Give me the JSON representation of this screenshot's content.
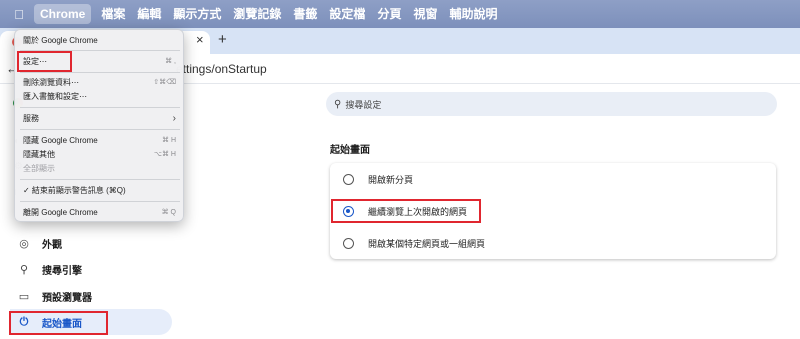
{
  "menubar": {
    "apple": "",
    "items": [
      "Chrome",
      "檔案",
      "編輯",
      "顯示方式",
      "瀏覽記錄",
      "書籤",
      "設定檔",
      "分頁",
      "視窗",
      "輔助說明"
    ]
  },
  "tabs": {
    "close": "×",
    "new": "+"
  },
  "address": {
    "back": "←",
    "url": "ettings/onStartup"
  },
  "search": {
    "icon": "⚲",
    "placeholder": "搜尋設定"
  },
  "chrome_menu": {
    "about": "關於 Google Chrome",
    "settings": "設定⋯",
    "settings_shortcut": "⌘ ,",
    "clear_data": "刪除瀏覽資料⋯",
    "clear_data_shortcut": "⇧⌘⌫",
    "import": "匯入書籤和設定⋯",
    "services": "服務",
    "services_chevron": "›",
    "hide": "隱藏 Google Chrome",
    "hide_shortcut": "⌘ H",
    "hide_others": "隱藏其他",
    "hide_others_shortcut": "⌥⌘ H",
    "show_all": "全部顯示",
    "warn_quit": "✓ 結束前顯示警告訊息 (⌘Q)",
    "quit": "離開 Google Chrome",
    "quit_shortcut": "⌘ Q"
  },
  "sidebar": {
    "partial_label": "...",
    "items": [
      {
        "icon": "◎",
        "label": "外觀"
      },
      {
        "icon": "⚲",
        "label": "搜尋引擎"
      },
      {
        "icon": "▭",
        "label": "預設瀏覽器"
      },
      {
        "icon": "⏻",
        "label": "起始畫面"
      }
    ]
  },
  "startup": {
    "title": "起始畫面",
    "options": [
      {
        "label": "開啟新分頁",
        "checked": false
      },
      {
        "label": "繼續瀏覽上次開啟的網頁",
        "checked": true
      },
      {
        "label": "開啟某個特定網頁或一組網頁",
        "checked": false
      }
    ]
  },
  "colors": {
    "accent": "#1a57c8",
    "highlight": "#e0262f",
    "menubar": "#8698c1"
  }
}
